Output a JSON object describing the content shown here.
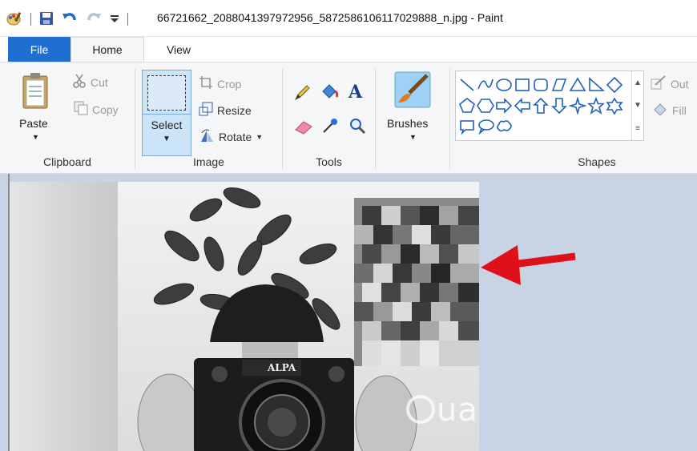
{
  "window": {
    "title": "66721662_2088041397972956_5872586106117029888_n.jpg - Paint"
  },
  "tabs": {
    "file": "File",
    "home": "Home",
    "view": "View"
  },
  "clipboard": {
    "paste": "Paste",
    "cut": "Cut",
    "copy": "Copy",
    "group_label": "Clipboard"
  },
  "image_group": {
    "select": "Select",
    "crop": "Crop",
    "resize": "Resize",
    "rotate": "Rotate",
    "group_label": "Image"
  },
  "tools": {
    "group_label": "Tools",
    "brushes": "Brushes"
  },
  "shapes": {
    "group_label": "Shapes",
    "outline": "Out",
    "fill": "Fill"
  },
  "canvas": {
    "camera_brand": "ALPA",
    "watermark": "uantrimang"
  },
  "colors": {
    "file_tab": "#1f6fd0",
    "ribbon_bg": "#f5f6f7",
    "select_highlight": "#cce4f7",
    "canvas_bg": "#c8d3e3",
    "arrow": "#e0101a"
  }
}
